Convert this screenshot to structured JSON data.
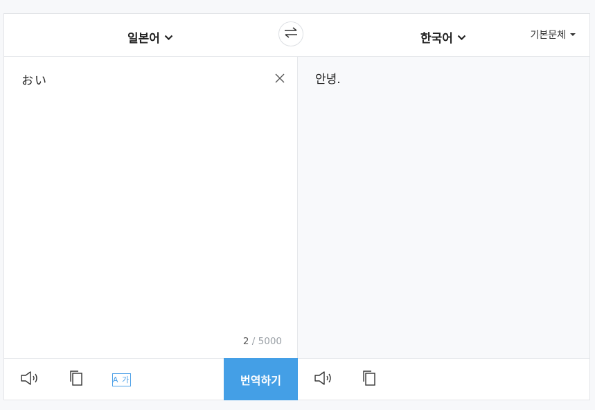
{
  "header": {
    "source_lang": "일본어",
    "target_lang": "한국어",
    "font_select": "기본문체"
  },
  "source": {
    "text": "おい",
    "count_current": "2",
    "count_max": "/ 5000"
  },
  "target": {
    "text": "안녕."
  },
  "footer": {
    "font_badge": "A 가",
    "translate_label": "번역하기"
  },
  "colors": {
    "accent": "#449fe6",
    "background": "#f7f8fa",
    "target_pane": "#f8f9fb"
  },
  "icons": [
    "chevron-down-icon",
    "swap-icon",
    "caret-down-icon",
    "close-icon",
    "speaker-icon",
    "copy-icon",
    "font-style-icon"
  ]
}
